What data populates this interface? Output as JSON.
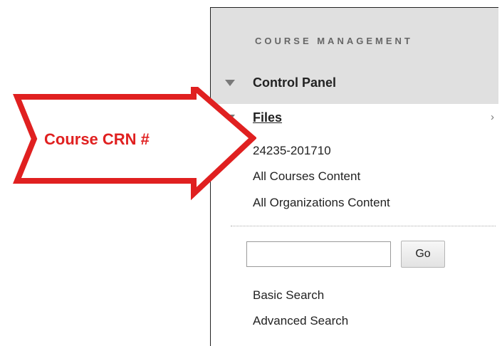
{
  "panel": {
    "header_title": "COURSE MANAGEMENT",
    "control_panel_label": "Control Panel",
    "files_label": "Files",
    "files_chevron": "›",
    "items": [
      "24235-201710",
      "All Courses Content",
      "All Organizations Content"
    ],
    "search": {
      "value": "",
      "placeholder": "",
      "go_label": "Go"
    },
    "search_links": [
      "Basic Search",
      "Advanced Search"
    ]
  },
  "callout": {
    "text": "Course CRN #",
    "color": "#e02020",
    "fill": "#ffffff"
  },
  "icons": {
    "control_panel": "triangle-down-icon",
    "files": "triangle-down-icon",
    "files_more": "chevron-right-icon"
  }
}
